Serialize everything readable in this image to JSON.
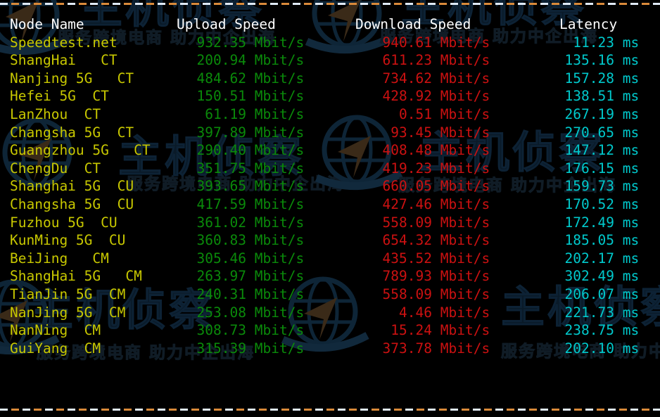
{
  "terminal": {
    "background_color": "#000000",
    "rule_colors": [
      "#dfe9f5",
      "#d98a3a"
    ],
    "colors": {
      "header": "#ffffff",
      "node": "#c8c800",
      "upload": "#0a8a0a",
      "download": "#cc1111",
      "latency": "#00c9cc"
    }
  },
  "watermark": {
    "brand": "主机侦察",
    "tagline": "服务跨境电商 助力中企出海",
    "logo_name": "globe-arrow-logo"
  },
  "table": {
    "headers": {
      "node": "Node Name",
      "upload": "Upload Speed",
      "download": "Download Speed",
      "latency": "Latency"
    },
    "units": {
      "speed": "Mbit/s",
      "latency": "ms"
    },
    "rows": [
      {
        "node": "Speedtest.net",
        "upload": "932.35",
        "download": "940.61",
        "latency": "11.23"
      },
      {
        "node": "ShangHai   CT",
        "upload": "200.94",
        "download": "611.23",
        "latency": "135.16"
      },
      {
        "node": "Nanjing 5G   CT",
        "upload": "484.62",
        "download": "734.62",
        "latency": "157.28"
      },
      {
        "node": "Hefei 5G  CT",
        "upload": "150.51",
        "download": "428.92",
        "latency": "138.51"
      },
      {
        "node": "LanZhou  CT",
        "upload": "61.19",
        "download": "0.51",
        "latency": "267.19"
      },
      {
        "node": "Changsha 5G  CT",
        "upload": "397.89",
        "download": "93.45",
        "latency": "270.65"
      },
      {
        "node": "Guangzhou 5G   CT",
        "upload": "290.40",
        "download": "408.48",
        "latency": "147.12"
      },
      {
        "node": "ChengDu  CT",
        "upload": "351.75",
        "download": "419.23",
        "latency": "176.15"
      },
      {
        "node": "Shanghai 5G  CU",
        "upload": "393.65",
        "download": "660.05",
        "latency": "159.73"
      },
      {
        "node": "Changsha 5G  CU",
        "upload": "417.59",
        "download": "427.46",
        "latency": "170.52"
      },
      {
        "node": "Fuzhou 5G  CU",
        "upload": "361.02",
        "download": "558.09",
        "latency": "172.49"
      },
      {
        "node": "KunMing 5G  CU",
        "upload": "360.83",
        "download": "654.32",
        "latency": "185.05"
      },
      {
        "node": "BeiJing   CM",
        "upload": "305.46",
        "download": "435.52",
        "latency": "202.17"
      },
      {
        "node": "ShangHai 5G   CM",
        "upload": "263.97",
        "download": "789.93",
        "latency": "302.49"
      },
      {
        "node": "TianJin 5G  CM",
        "upload": "240.31",
        "download": "558.09",
        "latency": "206.07"
      },
      {
        "node": "NanJing 5G  CM",
        "upload": "253.08",
        "download": "4.46",
        "latency": "221.73"
      },
      {
        "node": "NanNing  CM",
        "upload": "308.73",
        "download": "15.24",
        "latency": "238.75"
      },
      {
        "node": "GuiYang  CM",
        "upload": "315.39",
        "download": "373.78",
        "latency": "202.10"
      }
    ]
  }
}
